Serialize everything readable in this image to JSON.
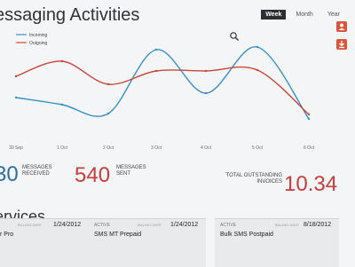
{
  "header": {
    "title": "essaging Activities",
    "tabs": [
      {
        "label": "Week",
        "active": true
      },
      {
        "label": "Month",
        "active": false
      },
      {
        "label": "Year",
        "active": false
      }
    ]
  },
  "colors": {
    "incoming": "#3a8fc7",
    "outgoing": "#c9473a",
    "accent": "#e0533b",
    "value_red": "#c43e3e",
    "value_blue": "#2f6f9f"
  },
  "chart_data": {
    "type": "line",
    "categories": [
      "30 Sep",
      "1 Oct",
      "2 Oct",
      "3 Oct",
      "4 Oct",
      "5 Oct",
      "6 Oct"
    ],
    "series": [
      {
        "name": "Incoming",
        "color": "#3a8fc7",
        "values": [
          0.32,
          0.24,
          0.14,
          0.86,
          0.37,
          0.89,
          0.08
        ]
      },
      {
        "name": "Outgoing",
        "color": "#c9473a",
        "values": [
          0.56,
          0.73,
          0.47,
          0.62,
          0.62,
          0.63,
          0.13
        ]
      }
    ],
    "legend": "top-left",
    "ylim": [
      0,
      1
    ],
    "grid": false
  },
  "stats": {
    "received": {
      "value": "30",
      "label_line1": "MESSAGES",
      "label_line2": "RECEIVED"
    },
    "sent": {
      "value": "540",
      "label_line1": "MESSAGES",
      "label_line2": "SENT"
    },
    "invoices": {
      "value": "10.34",
      "label_line1": "TOTAL OUTSTANDING",
      "label_line2": "INVOICES"
    }
  },
  "services": {
    "title": "ervices",
    "cards": [
      {
        "status": "",
        "billing_label": "BILLING DATE",
        "date": "1/24/2012",
        "name": "r Pro"
      },
      {
        "status": "ACTIVE",
        "billing_label": "BILLING DATE",
        "date": "1/24/2012",
        "name": "SMS MT Prepaid"
      },
      {
        "status": "ACTIVE",
        "billing_label": "BILLING DATE",
        "date": "8/18/2012",
        "name": "Bulk SMS Postpaid"
      }
    ]
  }
}
